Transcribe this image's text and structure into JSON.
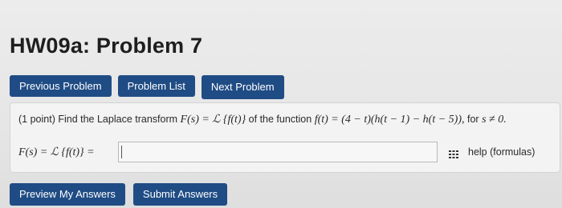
{
  "page": {
    "title": "HW09a: Problem 7"
  },
  "nav": {
    "previous_label": "Previous Problem",
    "list_label": "Problem List",
    "next_label": "Next Problem"
  },
  "problem": {
    "points": "(1 point)",
    "text_before": "Find the Laplace transform",
    "transform_expr": "F(s) = ℒ {f(t)}",
    "text_mid": "of the function",
    "function_expr": "f(t) = (4 − t)(h(t − 1) − h(t − 5)),",
    "text_for": "for",
    "condition_expr": "s ≠ 0."
  },
  "answer": {
    "label": "F(s) = ℒ {f(t)} =",
    "value": "",
    "help_label": "help (formulas)",
    "icon": "grid-icon"
  },
  "actions": {
    "preview_label": "Preview My Answers",
    "submit_label": "Submit Answers"
  },
  "colors": {
    "button": "#1f4c84",
    "background": "#e9e9e9",
    "box": "#f3f3f3"
  }
}
